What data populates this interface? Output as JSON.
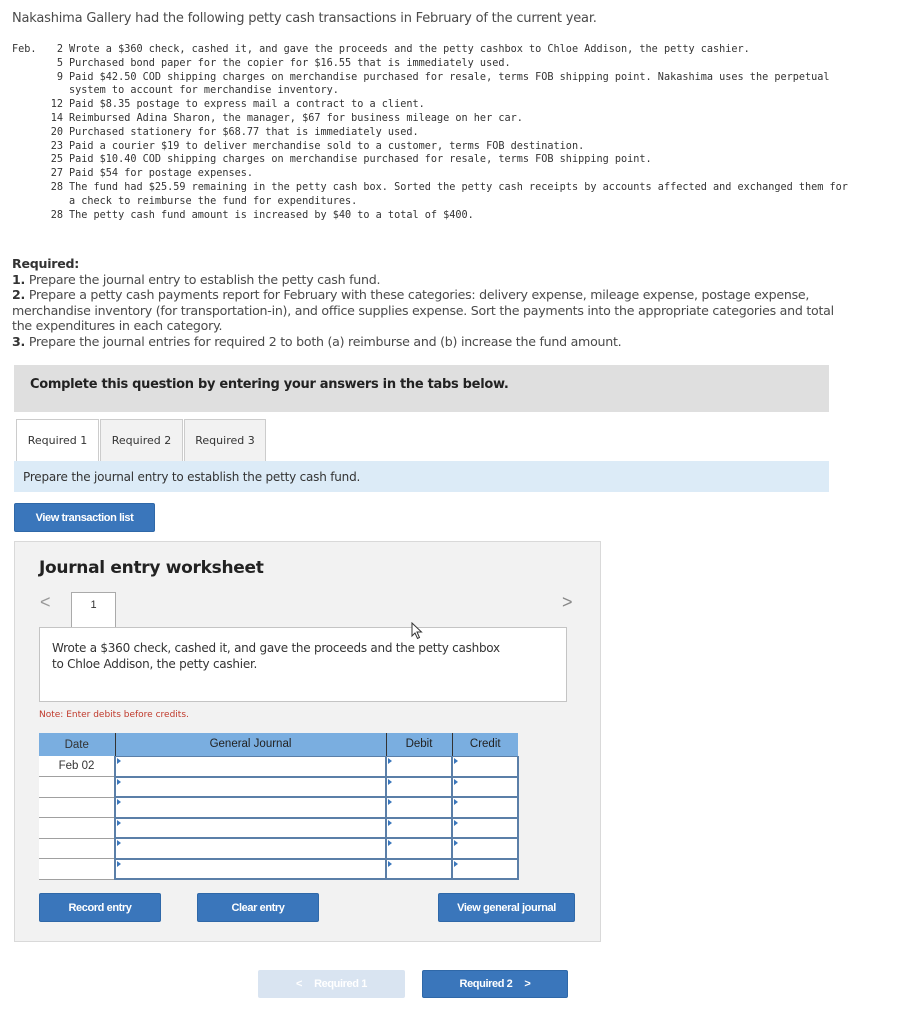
{
  "intro": "Nakashima Gallery had the following petty cash transactions in February of the current year.",
  "transactions": {
    "month": "Feb.",
    "items": [
      {
        "day": "2",
        "text": "Wrote a $360 check, cashed it, and gave the proceeds and the petty cashbox to Chloe Addison, the petty cashier."
      },
      {
        "day": "5",
        "text": "Purchased bond paper for the copier for $16.55 that is immediately used."
      },
      {
        "day": "9",
        "text": "Paid $42.50 COD shipping charges on merchandise purchased for resale, terms FOB shipping point. Nakashima uses the perpetual system to account for merchandise inventory."
      },
      {
        "day": "12",
        "text": "Paid $8.35 postage to express mail a contract to a client."
      },
      {
        "day": "14",
        "text": "Reimbursed Adina Sharon, the manager, $67 for business mileage on her car."
      },
      {
        "day": "20",
        "text": "Purchased stationery for $68.77 that is immediately used."
      },
      {
        "day": "23",
        "text": "Paid a courier $19 to deliver merchandise sold to a customer, terms FOB destination."
      },
      {
        "day": "25",
        "text": "Paid $10.40 COD shipping charges on merchandise purchased for resale, terms FOB shipping point."
      },
      {
        "day": "27",
        "text": "Paid $54 for postage expenses."
      },
      {
        "day": "28",
        "text": "The fund had $25.59 remaining in the petty cash box. Sorted the petty cash receipts by accounts affected and exchanged them for a check to reimburse the fund for expenditures."
      },
      {
        "day": "28",
        "text": "The petty cash fund amount is increased by $40 to a total of $400."
      }
    ]
  },
  "required": {
    "heading": "Required:",
    "items": [
      {
        "num": "1.",
        "text": " Prepare the journal entry to establish the petty cash fund."
      },
      {
        "num": "2.",
        "text": " Prepare a petty cash payments report for February with these categories: delivery expense, mileage expense, postage expense, merchandise inventory (for transportation-in), and office supplies expense. Sort the payments into the appropriate categories and total the expenditures in each category."
      },
      {
        "num": "3.",
        "text": " Prepare the journal entries for required 2 to both (a) reimburse and (b) increase the fund amount."
      }
    ]
  },
  "complete_banner": "Complete this question by entering your answers in the tabs below.",
  "tabs": [
    {
      "label": "Required 1",
      "active": true
    },
    {
      "label": "Required 2",
      "active": false
    },
    {
      "label": "Required 3",
      "active": false
    }
  ],
  "instruction": "Prepare the journal entry to establish the petty cash fund.",
  "view_transaction_list": "View transaction list",
  "worksheet": {
    "title": "Journal entry worksheet",
    "prev_icon": "<",
    "next_icon": ">",
    "page": "1",
    "description": "Wrote a $360 check, cashed it, and gave the proceeds and the petty cashbox to Chloe Addison, the petty cashier.",
    "note": "Note: Enter debits before credits.",
    "columns": [
      "Date",
      "General Journal",
      "Debit",
      "Credit"
    ],
    "rows": [
      {
        "date": "Feb 02",
        "account": "",
        "debit": "",
        "credit": ""
      },
      {
        "date": "",
        "account": "",
        "debit": "",
        "credit": ""
      },
      {
        "date": "",
        "account": "",
        "debit": "",
        "credit": ""
      },
      {
        "date": "",
        "account": "",
        "debit": "",
        "credit": ""
      },
      {
        "date": "",
        "account": "",
        "debit": "",
        "credit": ""
      },
      {
        "date": "",
        "account": "",
        "debit": "",
        "credit": ""
      }
    ],
    "buttons": {
      "record": "Record entry",
      "clear": "Clear entry",
      "view_general_journal": "View general journal"
    }
  },
  "nav": {
    "prev_label": "Required 1",
    "prev_icon": "<",
    "next_label": "Required 2",
    "next_icon": ">"
  },
  "colors": {
    "button_blue": "#3a76bb",
    "header_blue": "#7aaee0",
    "instruction_bg": "#dcebf7",
    "note_red": "#c0392b"
  }
}
